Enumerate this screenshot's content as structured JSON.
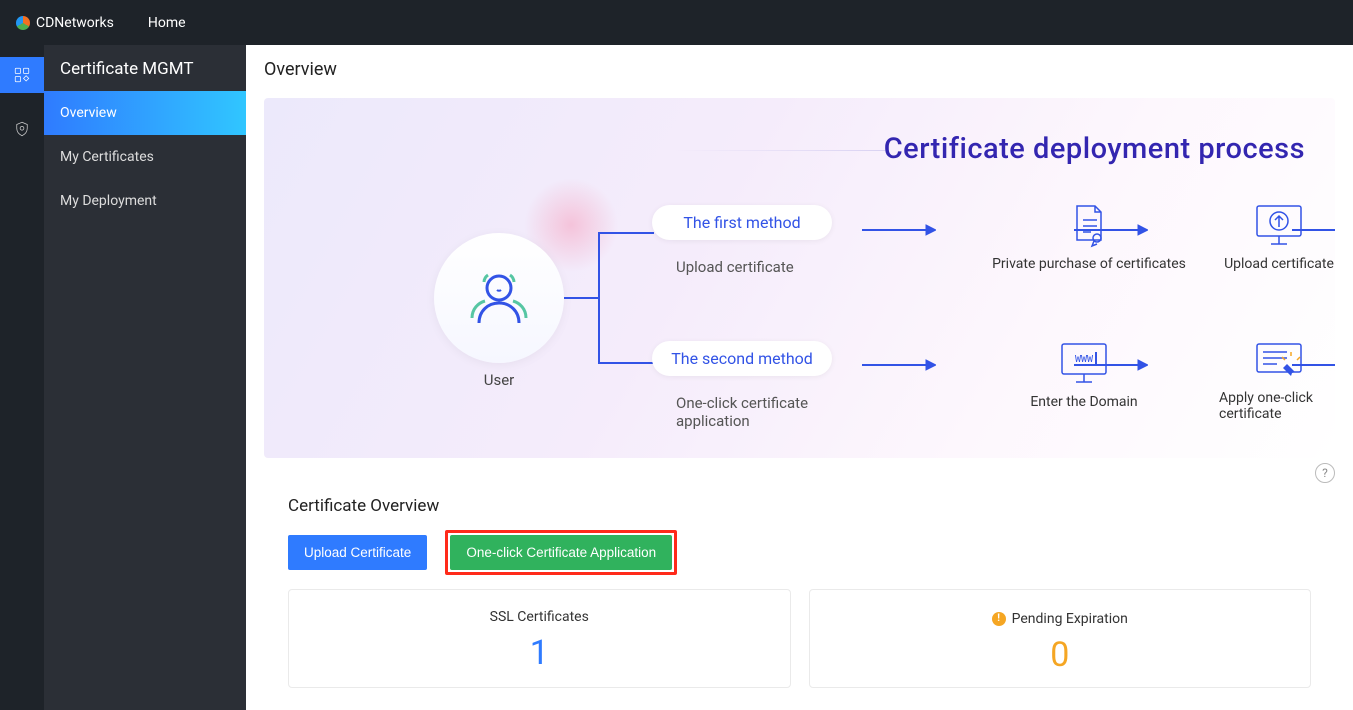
{
  "brand": "CDNetworks",
  "top_nav": {
    "home": "Home"
  },
  "sidebar": {
    "title": "Certificate MGMT",
    "items": [
      "Overview",
      "My Certificates",
      "My Deployment"
    ],
    "active": 0
  },
  "page": {
    "title": "Overview"
  },
  "process": {
    "title": "Certificate deployment process",
    "user_label": "User",
    "method1": {
      "label": "The first method",
      "sub": "Upload certificate"
    },
    "method2": {
      "label": "The second method",
      "sub": "One-click certificate application"
    },
    "row1": {
      "step1": "Private purchase of certificates",
      "step2": "Upload certificate"
    },
    "row2": {
      "step1": "Enter the Domain",
      "step2": "Apply one-click certificate"
    }
  },
  "overview": {
    "title": "Certificate Overview",
    "buttons": {
      "upload": "Upload Certificate",
      "oneclick": "One-click Certificate Application"
    },
    "stats": {
      "ssl_label": "SSL Certificates",
      "ssl_value": "1",
      "pending_label": "Pending Expiration",
      "pending_value": "0"
    }
  },
  "icons": {
    "apps": "apps-icon",
    "shield": "shield-icon"
  }
}
